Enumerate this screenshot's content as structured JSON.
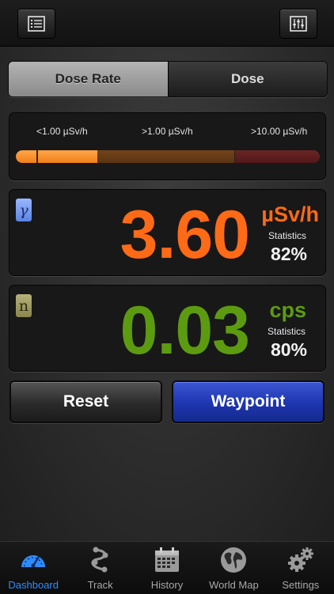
{
  "header": {
    "left_button_icon": "list-icon",
    "right_button_icon": "sliders-icon"
  },
  "segmented": {
    "items": [
      {
        "label": "Dose Rate",
        "active": true
      },
      {
        "label": "Dose",
        "active": false
      }
    ]
  },
  "scale": {
    "labels": [
      "<1.00 µSv/h",
      ">1.00 µSv/h",
      ">10.00 µSv/h"
    ],
    "colors": {
      "low": "#f5851f",
      "mid": "#6b4017",
      "high": "#6b2020"
    },
    "fill_fraction": 0.27
  },
  "gamma": {
    "badge": "γ",
    "value": "3.60",
    "unit": "µSv/h",
    "stat_label": "Statistics",
    "stat_value": "82%",
    "color": "#ff6a16"
  },
  "neutron": {
    "badge": "n",
    "value": "0.03",
    "unit": "cps",
    "stat_label": "Statistics",
    "stat_value": "80%",
    "color": "#5c9b10"
  },
  "buttons": {
    "reset": "Reset",
    "waypoint": "Waypoint"
  },
  "tabs": [
    {
      "label": "Dashboard",
      "icon": "gauge-icon",
      "active": true
    },
    {
      "label": "Track",
      "icon": "track-icon",
      "active": false
    },
    {
      "label": "History",
      "icon": "calendar-icon",
      "active": false
    },
    {
      "label": "World Map",
      "icon": "globe-icon",
      "active": false
    },
    {
      "label": "Settings",
      "icon": "gears-icon",
      "active": false
    }
  ],
  "accent_color": "#2f8cff"
}
